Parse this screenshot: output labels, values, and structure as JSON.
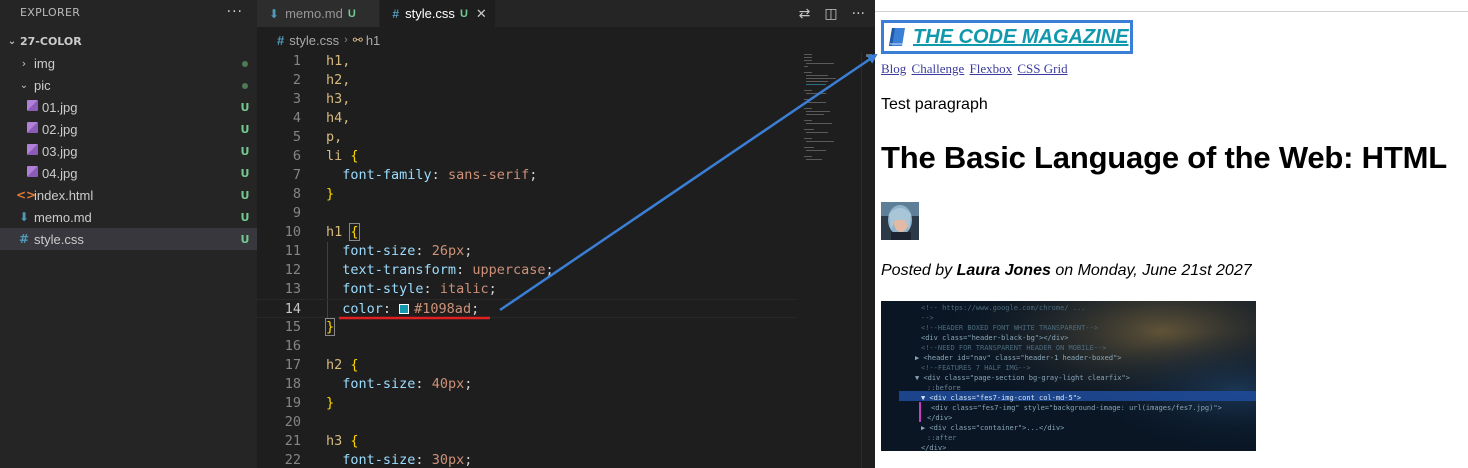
{
  "sidebar": {
    "title": "EXPLORER",
    "more": "···",
    "folder": "27-COLOR",
    "items": [
      {
        "label": "img",
        "status": "",
        "kind": "folder"
      },
      {
        "label": "pic",
        "status": "",
        "kind": "folder-open"
      },
      {
        "label": "01.jpg",
        "status": "U",
        "kind": "image"
      },
      {
        "label": "02.jpg",
        "status": "U",
        "kind": "image"
      },
      {
        "label": "03.jpg",
        "status": "U",
        "kind": "image"
      },
      {
        "label": "04.jpg",
        "status": "U",
        "kind": "image"
      },
      {
        "label": "index.html",
        "status": "U",
        "kind": "html"
      },
      {
        "label": "memo.md",
        "status": "U",
        "kind": "markdown"
      },
      {
        "label": "style.css",
        "status": "U",
        "kind": "css"
      }
    ]
  },
  "tabs": [
    {
      "label": "memo.md",
      "status": "U",
      "icon": "markdown-icon"
    },
    {
      "label": "style.css",
      "status": "U",
      "icon": "css-icon"
    }
  ],
  "breadcrumb": {
    "file": "style.css",
    "symbol": "h1"
  },
  "code": {
    "lines": [
      "1",
      "2",
      "3",
      "4",
      "5",
      "6",
      "7",
      "8",
      "9",
      "10",
      "11",
      "12",
      "13",
      "14",
      "15",
      "16",
      "17",
      "18",
      "19",
      "20",
      "21",
      "22"
    ],
    "text": {
      "l1": "h1,",
      "l2": "h2,",
      "l3": "h3,",
      "l4": "h4,",
      "l5": "p,",
      "l6": "li",
      "open": "{",
      "close": "}",
      "font_family_prop": "font-family",
      "font_family_val": "sans-serif",
      "h1_sel": "h1",
      "font_size_prop": "font-size",
      "font_size_26": "26px",
      "text_transform_prop": "text-transform",
      "text_transform_val": "uppercase",
      "font_style_prop": "font-style",
      "font_style_val": "italic",
      "color_prop": "color",
      "color_val": "#1098ad",
      "h2_sel": "h2",
      "font_size_40": "40px",
      "h3_sel": "h3",
      "font_size_30": "30px"
    },
    "swatch_color": "#1098ad"
  },
  "preview": {
    "logo_title": "The Code Magazine",
    "nav": [
      "Blog",
      "Challenge",
      "Flexbox",
      "CSS Grid"
    ],
    "paragraph": "Test paragraph",
    "post_title": "The Basic Language of the Web: HTML",
    "posted_prefix": "Posted by ",
    "author": "Laura Jones",
    "posted_suffix": " on Monday, June 21st 2027"
  },
  "colors": {
    "accent": "#1098ad",
    "annotation_arrow": "#3a7fd5",
    "annotation_underline": "#e02020",
    "untracked": "#73c991"
  }
}
